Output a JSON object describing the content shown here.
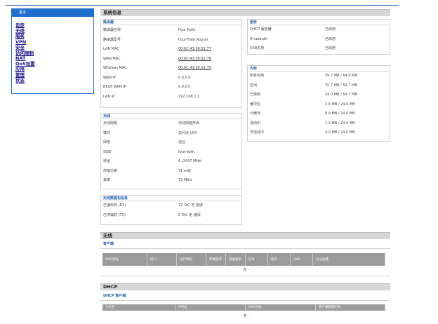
{
  "nav": {
    "heading": "基本",
    "items": [
      "设定",
      "无线",
      "服务",
      "VPN",
      "安全",
      "访问限制",
      "NAT",
      "QoS设置",
      "应用",
      "管理",
      "状态"
    ]
  },
  "system": {
    "bar_title": "系统信息",
    "router": {
      "title": "路由器",
      "rows": [
        {
          "k": "路由器名称",
          "v": "Four-Faith"
        },
        {
          "k": "路由器型号",
          "v": "Four-Faith Router"
        },
        {
          "k": "LAN MAC",
          "v": "00:0C:43:30:52:77"
        },
        {
          "k": "WAN MAC",
          "v": "00:0C:43:30:52:78"
        },
        {
          "k": "Wireless MAC",
          "v": "00:0C:43:30:52:79"
        },
        {
          "k": "WAN IP",
          "v": "0.0.0.0"
        },
        {
          "k": "BKUP WAN IP",
          "v": "0.0.0.0"
        },
        {
          "k": "LAN IP",
          "v": "192.168.1.1"
        }
      ]
    },
    "wireless": {
      "title": "无线",
      "rows": [
        {
          "k": "无线网络",
          "v": "无线网络开启"
        },
        {
          "k": "模式",
          "v": "访问点 (AP)"
        },
        {
          "k": "网络",
          "v": "混合"
        },
        {
          "k": "SSID",
          "v": "four-faith"
        },
        {
          "k": "频道",
          "v": "6 (2437 MHz)"
        },
        {
          "k": "传输功率",
          "v": "71 mW"
        },
        {
          "k": "速率",
          "v": "72 Mb/s"
        }
      ]
    },
    "packets": {
      "title": "无线数据包信息",
      "rows": [
        {
          "k": "已接收到 (RX)",
          "v": "72 OK, 无 错误"
        },
        {
          "k": "已传输的 (TX)",
          "v": "0 OK, 无 错误"
        }
      ]
    },
    "services": {
      "title": "服务",
      "rows": [
        {
          "k": "DHCP 服务器",
          "v": "已启用"
        },
        {
          "k": "ff-radauth",
          "v": "已启用"
        },
        {
          "k": "USB支持",
          "v": "已启用"
        }
      ]
    },
    "memory": {
      "title": "内存",
      "rows": [
        {
          "k": "所有可用",
          "v": "59.7 MB / 64.0 MB"
        },
        {
          "k": "空闲",
          "v": "35.7 MB / 59.7 MB"
        },
        {
          "k": "已使用",
          "v": "24.0 MB / 59.7 MB"
        },
        {
          "k": "缓冲区",
          "v": "2.6 MB / 24.0 MB"
        },
        {
          "k": "已缓存",
          "v": "8.9 MB / 24.0 MB"
        },
        {
          "k": "活动中",
          "v": "1.3 MB / 24.0 MB"
        },
        {
          "k": "非活动中",
          "v": "2.0 MB / 24.0 MB"
        }
      ]
    }
  },
  "wireless_section": {
    "bar_title": "无线",
    "subtitle": "客户端",
    "columns": [
      "MAC地址",
      "接口",
      "运行时间",
      "传输速率",
      "接收速率",
      "信号",
      "噪声",
      "SNR",
      "信号质量"
    ],
    "empty": "- 无 -"
  },
  "dhcp_section": {
    "bar_title": "DHCP",
    "subtitle": "DHCP 客户端",
    "columns": [
      "主机名",
      "IP地址",
      "MAC地址",
      "客户端租期时间"
    ],
    "empty": "- 无 -"
  },
  "colors": {
    "accent": "#1f6fce",
    "bar": "#d6d6d6",
    "table_head": "#9b9b9b"
  }
}
